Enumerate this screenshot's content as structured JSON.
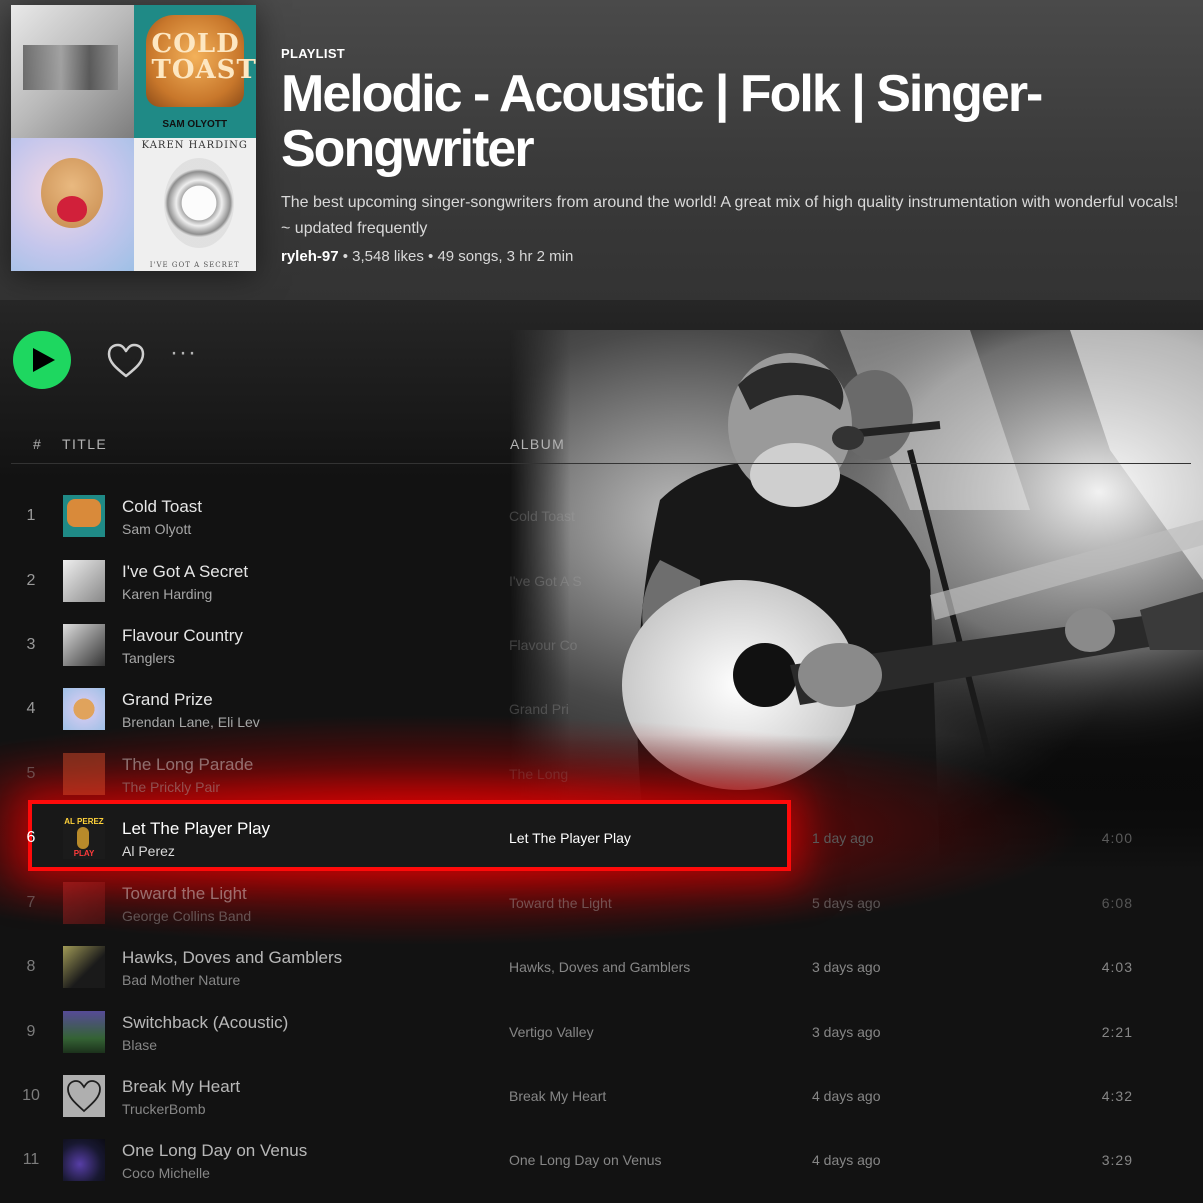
{
  "playlist": {
    "type_label": "PLAYLIST",
    "title": "Melodic - Acoustic | Folk | Singer-Songwriter",
    "description": "The best upcoming singer-songwriters from around the world! A great mix of high quality instrumentation with wonderful vocals! ~ updated frequently",
    "owner": "ryleh-97",
    "likes": " • 3,548 likes • ",
    "songs": "49 songs,",
    "duration": " 3 hr 2 min"
  },
  "cover_art": {
    "tile2_title": "COLD TOAST",
    "tile2_artist": "SAM OLYOTT",
    "tile4_title": "KAREN HARDING",
    "tile4_caption": "I'VE GOT A SECRET"
  },
  "controls": {
    "play_icon": "play-icon",
    "like_icon": "heart-icon",
    "more_label": "···"
  },
  "columns": {
    "number": "#",
    "title": "TITLE",
    "album": "ALBUM"
  },
  "colors": {
    "accent_green": "#1ed760",
    "highlight_red": "#ff0a0a",
    "background": "#121212"
  },
  "tracks": [
    {
      "num": "1",
      "title": "Cold Toast",
      "artist": "Sam Olyott",
      "album": "Cold Toast",
      "added": "",
      "duration": ""
    },
    {
      "num": "2",
      "title": "I've Got A Secret",
      "artist": "Karen Harding",
      "album": "I've Got A S",
      "added": "",
      "duration": ""
    },
    {
      "num": "3",
      "title": "Flavour Country",
      "artist": "Tanglers",
      "album": "Flavour Co",
      "added": "",
      "duration": ""
    },
    {
      "num": "4",
      "title": "Grand Prize",
      "artist": "Brendan Lane, Eli Lev",
      "album": "Grand Pri",
      "added": "",
      "duration": ""
    },
    {
      "num": "5",
      "title": "The Long Parade",
      "artist": "The Prickly Pair",
      "album": "The Long",
      "added": "",
      "duration": ""
    },
    {
      "num": "6",
      "title": "Let The Player Play",
      "artist": "Al Perez",
      "album": "Let The Player Play",
      "added": "1 day ago",
      "duration": "4:00"
    },
    {
      "num": "7",
      "title": "Toward the Light",
      "artist": "George Collins Band",
      "album": "Toward the Light",
      "added": "5 days ago",
      "duration": "6:08"
    },
    {
      "num": "8",
      "title": "Hawks, Doves and Gamblers",
      "artist": "Bad Mother Nature",
      "album": "Hawks, Doves and Gamblers",
      "added": "3 days ago",
      "duration": "4:03"
    },
    {
      "num": "9",
      "title": "Switchback (Acoustic)",
      "artist": "Blase",
      "album": "Vertigo Valley",
      "added": "3 days ago",
      "duration": "2:21"
    },
    {
      "num": "10",
      "title": "Break My Heart",
      "artist": "TruckerBomb",
      "album": "Break My Heart",
      "added": "4 days ago",
      "duration": "4:32"
    },
    {
      "num": "11",
      "title": "One Long Day on Venus",
      "artist": "Coco Michelle",
      "album": "One Long Day on Venus",
      "added": "4 days ago",
      "duration": "3:29"
    }
  ],
  "thumb_text": {
    "t1": "COLD TOAST",
    "t6_top": "AL PEREZ",
    "t6_bottom": "PLAY"
  }
}
